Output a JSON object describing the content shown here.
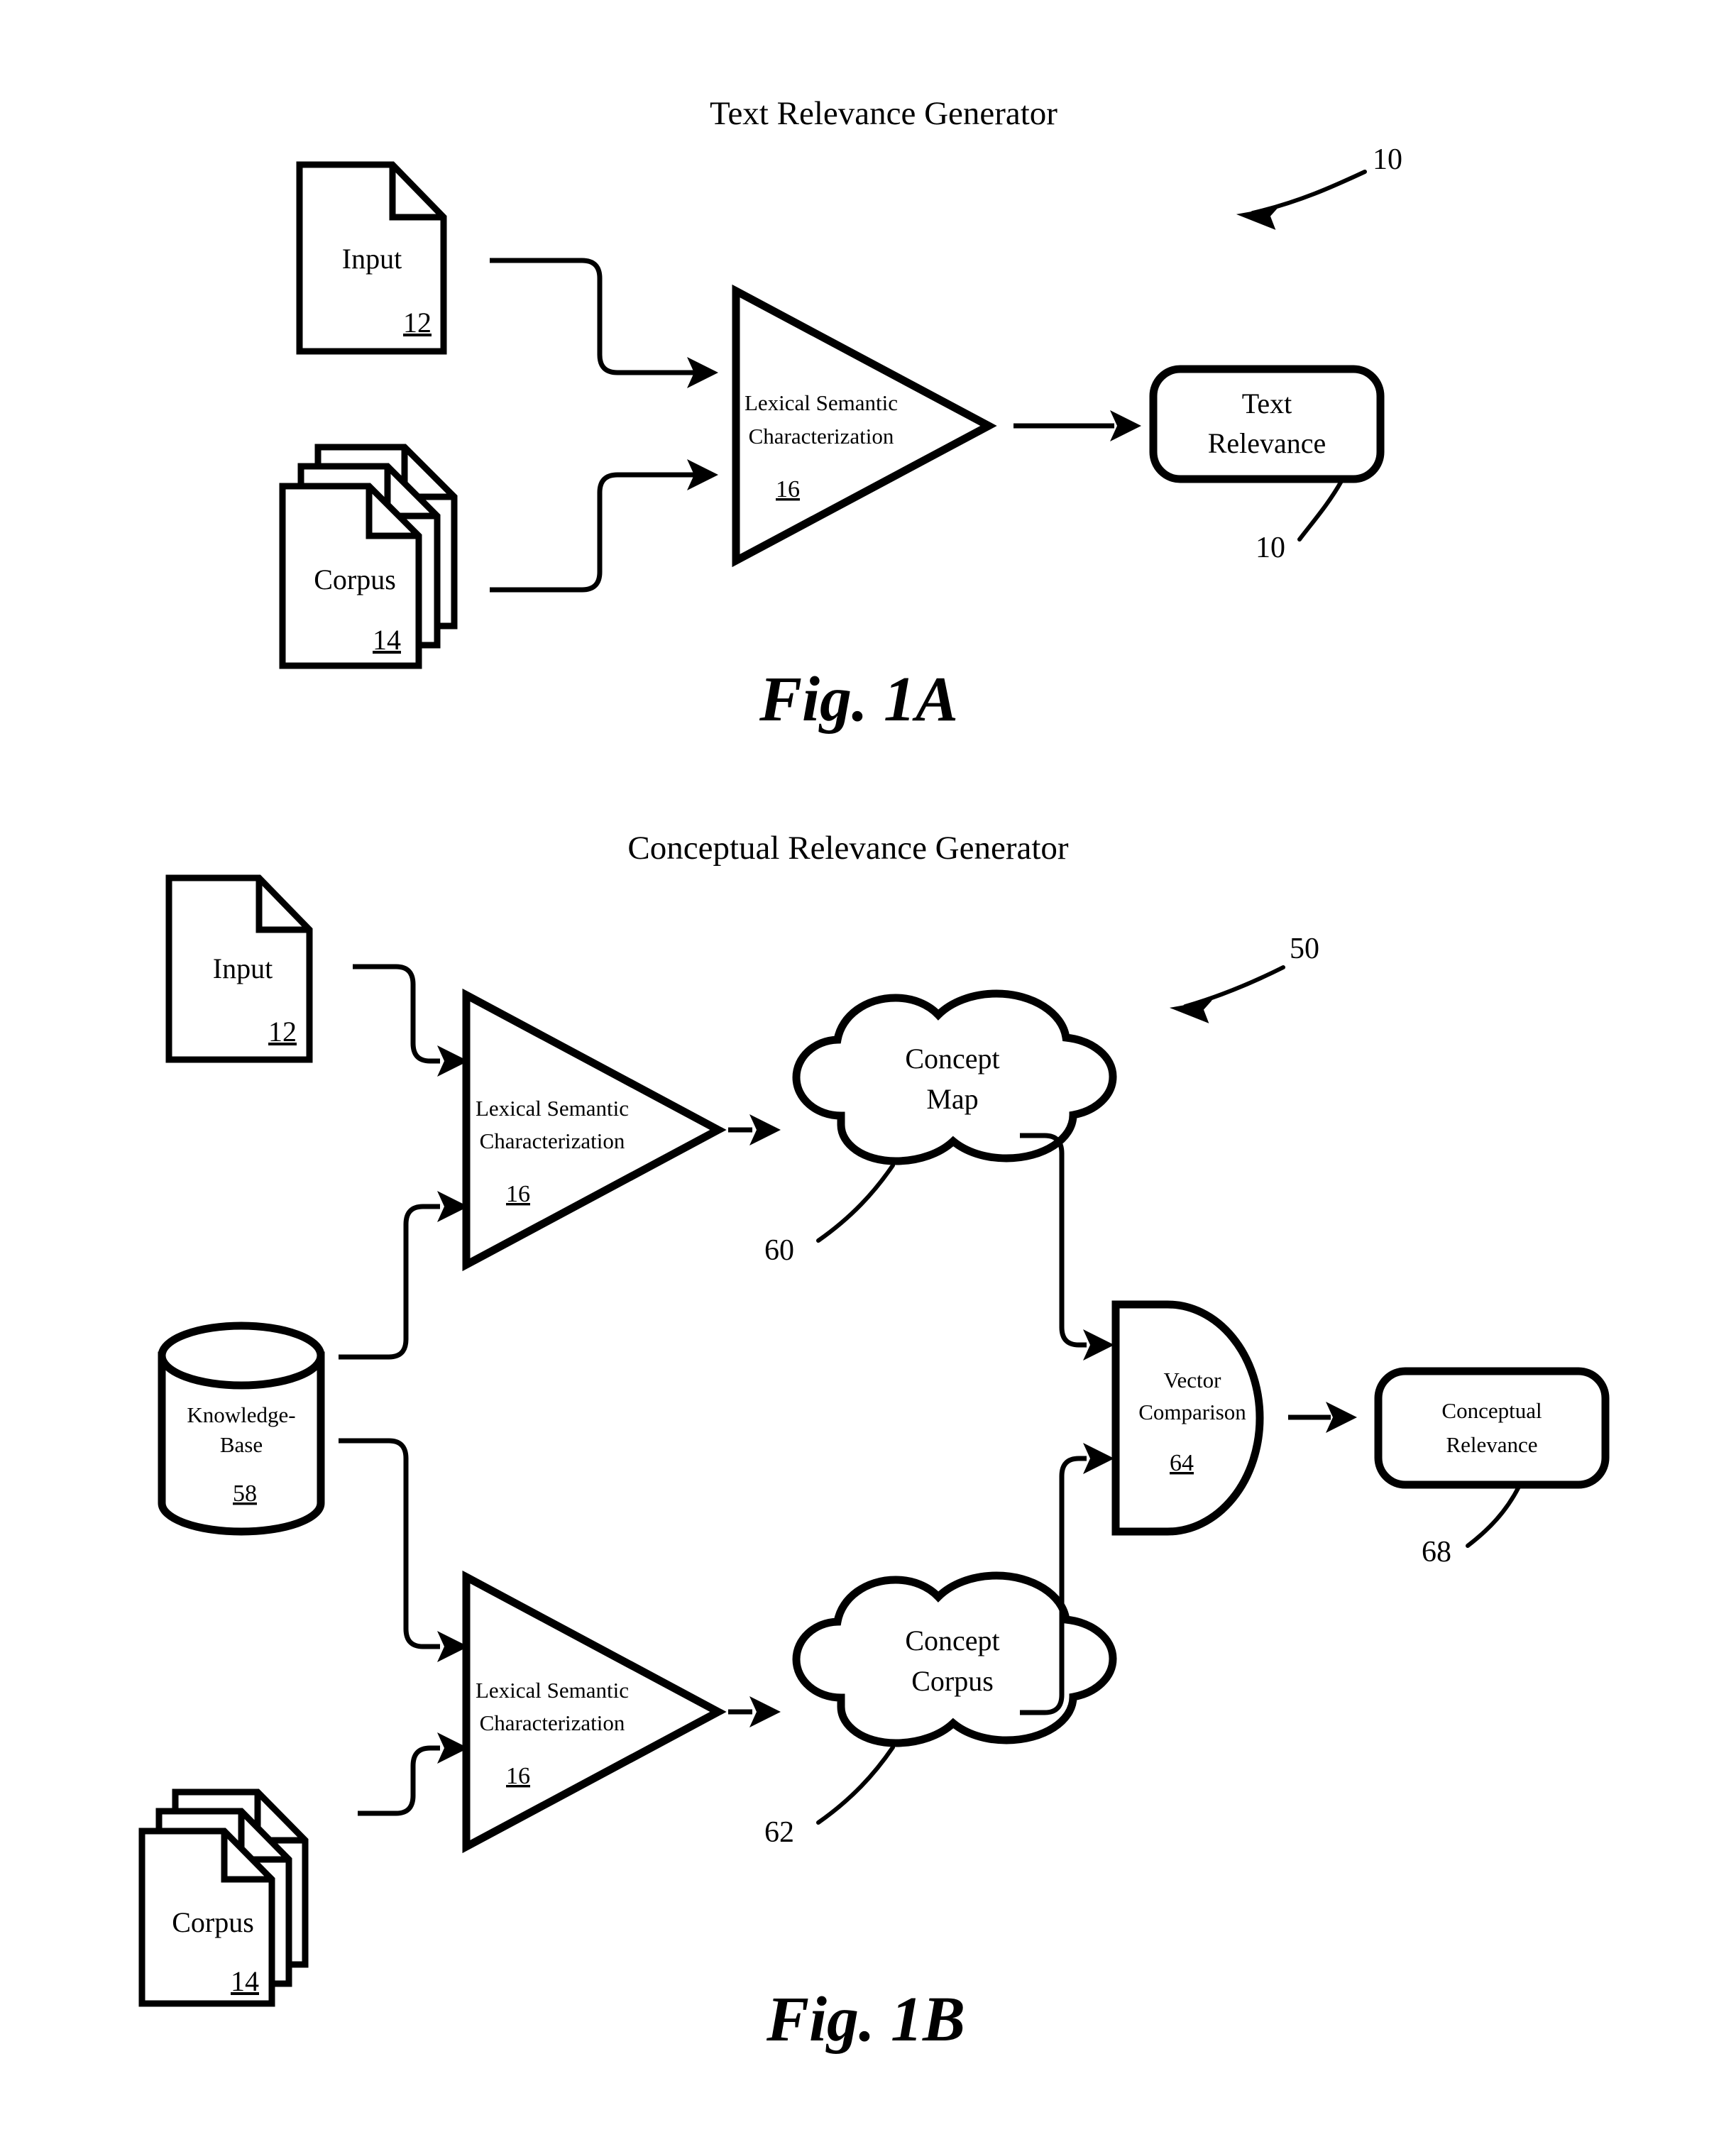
{
  "document": {
    "type": "patent-figure-sheet",
    "figures": [
      "Fig. 1A",
      "Fig. 1B"
    ]
  },
  "fig1a": {
    "title": "Text Relevance Generator",
    "caption": "Fig. 1A",
    "overall_ref": "10",
    "nodes": {
      "input": {
        "label": "Input",
        "ref": "12",
        "shape": "document"
      },
      "corpus": {
        "label": "Corpus",
        "ref": "14",
        "shape": "document-stack"
      },
      "processor": {
        "label_line1": "Lexical Semantic",
        "label_line2": "Characterization",
        "ref": "16",
        "shape": "triangle-right"
      },
      "output": {
        "label_line1": "Text",
        "label_line2": "Relevance",
        "ref": "10",
        "shape": "rounded-rect"
      }
    },
    "edges": [
      {
        "from": "input",
        "to": "processor"
      },
      {
        "from": "corpus",
        "to": "processor"
      },
      {
        "from": "processor",
        "to": "output"
      }
    ]
  },
  "fig1b": {
    "title": "Conceptual Relevance Generator",
    "caption": "Fig. 1B",
    "overall_ref": "50",
    "nodes": {
      "input": {
        "label": "Input",
        "ref": "12",
        "shape": "document"
      },
      "knowledge_base": {
        "label_line1": "Knowledge-",
        "label_line2": "Base",
        "ref": "58",
        "shape": "cylinder"
      },
      "corpus": {
        "label": "Corpus",
        "ref": "14",
        "shape": "document-stack"
      },
      "processor_top": {
        "label_line1": "Lexical Semantic",
        "label_line2": "Characterization",
        "ref": "16",
        "shape": "triangle-right"
      },
      "processor_bottom": {
        "label_line1": "Lexical Semantic",
        "label_line2": "Characterization",
        "ref": "16",
        "shape": "triangle-right"
      },
      "concept_map": {
        "label_line1": "Concept",
        "label_line2": "Map",
        "ref": "60",
        "shape": "cloud"
      },
      "concept_corpus": {
        "label_line1": "Concept",
        "label_line2": "Corpus",
        "ref": "62",
        "shape": "cloud"
      },
      "vector_comparison": {
        "label_line1": "Vector",
        "label_line2": "Comparison",
        "ref": "64",
        "shape": "d-shape"
      },
      "output": {
        "label_line1": "Conceptual",
        "label_line2": "Relevance",
        "ref": "68",
        "shape": "rounded-rect"
      }
    },
    "edges": [
      {
        "from": "input",
        "to": "processor_top"
      },
      {
        "from": "knowledge_base",
        "to": "processor_top"
      },
      {
        "from": "knowledge_base",
        "to": "processor_bottom"
      },
      {
        "from": "corpus",
        "to": "processor_bottom"
      },
      {
        "from": "processor_top",
        "to": "concept_map"
      },
      {
        "from": "processor_bottom",
        "to": "concept_corpus"
      },
      {
        "from": "concept_map",
        "to": "vector_comparison"
      },
      {
        "from": "concept_corpus",
        "to": "vector_comparison"
      },
      {
        "from": "vector_comparison",
        "to": "output"
      }
    ]
  },
  "colors": {
    "ink": "#000000",
    "paper": "#ffffff"
  }
}
